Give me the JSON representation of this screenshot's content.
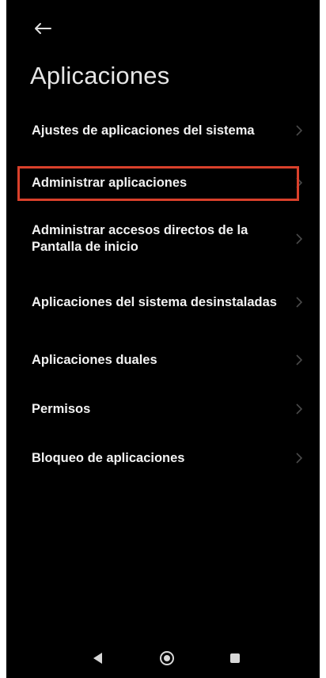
{
  "header": {
    "back_icon": "arrow-left-icon",
    "title": "Aplicaciones"
  },
  "menu": {
    "items": [
      {
        "label": "Ajustes de aplicaciones del sistema",
        "icon": "chevron-right-icon"
      },
      {
        "label": "Administrar aplicaciones",
        "icon": "chevron-right-icon",
        "highlighted": true
      },
      {
        "label": "Administrar accesos directos de la Pantalla de inicio",
        "icon": "chevron-right-icon"
      },
      {
        "label": "Aplicaciones del sistema desinstaladas",
        "icon": "chevron-right-icon"
      },
      {
        "label": "Aplicaciones duales",
        "icon": "chevron-right-icon"
      },
      {
        "label": "Permisos",
        "icon": "chevron-right-icon"
      },
      {
        "label": "Bloqueo de aplicaciones",
        "icon": "chevron-right-icon"
      }
    ]
  },
  "highlight_color": "#d9402b",
  "navbar": {
    "buttons": [
      "back-triangle-icon",
      "home-circle-icon",
      "recents-square-icon"
    ]
  }
}
